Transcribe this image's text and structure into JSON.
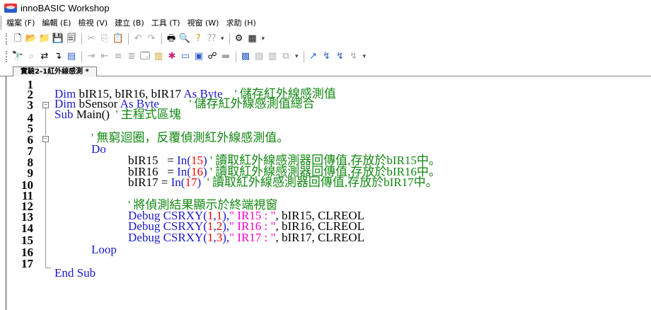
{
  "window": {
    "title": "innoBASIC Workshop"
  },
  "menu": [
    "檔案 (F)",
    "編輯 (E)",
    "檢視 (V)",
    "建立 (B)",
    "工具 (T)",
    "視窗 (W)",
    "求助 (H)"
  ],
  "tab": {
    "label": "實驗2-1紅外線感測 *"
  },
  "code": {
    "line_numbers": [
      "1",
      "2",
      "3",
      "4",
      "5",
      "6",
      "7",
      "8",
      "9",
      "10",
      "11",
      "12",
      "13",
      "14",
      "15",
      "16",
      "17"
    ],
    "l1": {
      "kw1": "Dim",
      "t1": " bIR15, bIR16, bIR17 ",
      "kw2": "As",
      "t2": " ",
      "kw3": "Byte",
      "c": "    ' 儲存紅外線感測值"
    },
    "l2": {
      "kw1": "Dim",
      "t1": " bSensor ",
      "kw2": "As",
      "t2": " ",
      "kw3": "Byte",
      "c": "          ' 儲存紅外線感測值總合"
    },
    "l3": {
      "kw1": "Sub",
      "t1": " Main()  ",
      "c": "' 主程式區塊"
    },
    "l5": {
      "c": "' 無窮迴圈，反覆偵測紅外線感測值。"
    },
    "l6": {
      "kw1": "Do"
    },
    "l7": {
      "t1": "bIR15   = ",
      "kw1": "In",
      "p1": "(",
      "n1": "15",
      "p2": ")",
      "c": " ' 讀取紅外線感測器回傳值,存放於bIR15中。"
    },
    "l8": {
      "t1": "bIR16   = ",
      "kw1": "In",
      "p1": "(",
      "n1": "16",
      "p2": ")",
      "c": " ' 讀取紅外線感測器回傳值,存放於bIR16中。"
    },
    "l9": {
      "t1": "bIR17 = ",
      "kw1": "In",
      "p1": "(",
      "n1": "17",
      "p2": ")",
      "c": "  ' 讀取紅外線感測器回傳值,存放於bIR17中。"
    },
    "l11": {
      "c": "' 將偵測結果顯示於終端視窗"
    },
    "l12": {
      "kw1": "Debug",
      "t1": " ",
      "kw2": "CSRXY",
      "p1": "(",
      "n1": "1",
      "p2": ",",
      "n2": "1",
      "p3": "),",
      "s": "\" IR15 : \"",
      "t2": ", bIR15, CLREOL"
    },
    "l13": {
      "kw1": "Debug",
      "t1": " ",
      "kw2": "CSRXY",
      "p1": "(",
      "n1": "1",
      "p2": ",",
      "n2": "2",
      "p3": "),",
      "s": "\" IR16 : \"",
      "t2": ", bIR16, CLREOL"
    },
    "l14": {
      "kw1": "Debug",
      "t1": " ",
      "kw2": "CSRXY",
      "p1": "(",
      "n1": "1",
      "p2": ",",
      "n2": "3",
      "p3": "),",
      "s": "\" IR17 : \"",
      "t2": ", bIR17, CLREOL"
    },
    "l15": {
      "kw1": "Loop"
    },
    "l17": {
      "kw1": "End",
      "t1": " ",
      "kw2": "Sub"
    }
  },
  "colors": {
    "keyword": "#1a1acc",
    "comment": "#118811",
    "number": "#ff0000",
    "string": "#ff00cc"
  }
}
